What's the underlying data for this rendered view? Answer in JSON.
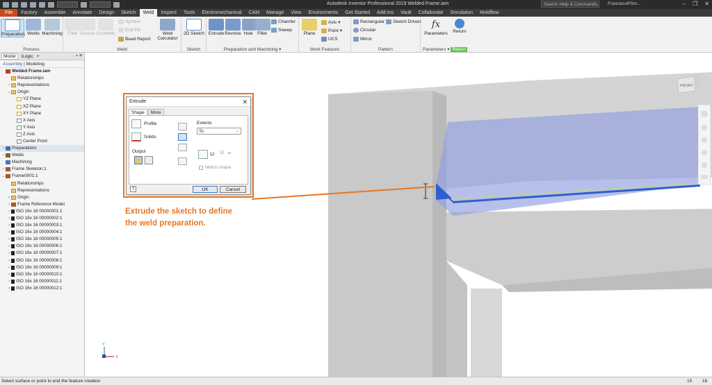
{
  "titlebar": {
    "app_title": "Autodesk Inventor Professional 2019   Welded Frame.iam",
    "search_placeholder": "Search Help & Commands...",
    "user": "FranciscoPSm...",
    "win_controls": [
      "–",
      "❐",
      "✕"
    ]
  },
  "tabs": [
    "File",
    "Factory",
    "Assemble",
    "Annotate",
    "Design",
    "Sketch",
    "Weld",
    "Inspect",
    "Tools",
    "Electromechanical",
    "CAM",
    "Manage",
    "View",
    "Environments",
    "Get Started",
    "Add-Ins",
    "Vault",
    "Collaborate",
    "Simulation",
    "Moldflow"
  ],
  "active_tab": "Weld",
  "ribbon": {
    "process": {
      "title": "Process",
      "preparation": "Preparation",
      "welds": "Welds",
      "machining": "Machining"
    },
    "weld": {
      "title": "Weld",
      "fillet": "Fillet",
      "groove": "Groove",
      "cosmetic": "Cosmetic",
      "symbol": "Symbol",
      "end_fill": "End Fill",
      "bead_report": "Bead Report",
      "weld_calculator_1": "Weld",
      "weld_calculator_2": "Calculator"
    },
    "sketch": {
      "title": "Sketch",
      "sketch_2d": "2D Sketch"
    },
    "prep_machining": {
      "title": "Preparation and Machining",
      "extrude": "Extrude",
      "revolve": "Revolve",
      "hole": "Hole",
      "fillet": "Fillet",
      "chamfer": "Chamfer",
      "sweep": "Sweep"
    },
    "work_features": {
      "title": "Work Features",
      "plane": "Plane",
      "axis": "Axis",
      "point": "Point",
      "ucs": "UCS"
    },
    "pattern": {
      "title": "Pattern",
      "rectangular": "Rectangular",
      "circular": "Circular",
      "mirror": "Mirror",
      "sketch_driven": "Sketch Driven"
    },
    "parameters": {
      "title": "Parameters",
      "parameters": "Parameters",
      "return": "Return",
      "return_title": "Return"
    }
  },
  "browser": {
    "tabs": [
      "Model",
      "iLogic"
    ],
    "mode_assembly": "Assembly",
    "mode_modeling": "Modeling",
    "items": [
      {
        "label": "Welded Frame.iam",
        "indent": 0,
        "icon": "assembly",
        "bold": true,
        "twisty": ""
      },
      {
        "label": "Relationships",
        "indent": 1,
        "icon": "folder",
        "twisty": ""
      },
      {
        "label": "Representations",
        "indent": 1,
        "icon": "folder",
        "twisty": "›"
      },
      {
        "label": "Origin",
        "indent": 1,
        "icon": "folder",
        "twisty": "⌄"
      },
      {
        "label": "YZ Plane",
        "indent": 2,
        "icon": "plane",
        "twisty": ""
      },
      {
        "label": "XZ Plane",
        "indent": 2,
        "icon": "plane",
        "twisty": ""
      },
      {
        "label": "XY Plane",
        "indent": 2,
        "icon": "plane",
        "twisty": ""
      },
      {
        "label": "X Axis",
        "indent": 2,
        "icon": "axis",
        "twisty": ""
      },
      {
        "label": "Y Axis",
        "indent": 2,
        "icon": "axis",
        "twisty": ""
      },
      {
        "label": "Z Axis",
        "indent": 2,
        "icon": "axis",
        "twisty": ""
      },
      {
        "label": "Center Point",
        "indent": 2,
        "icon": "point",
        "twisty": ""
      },
      {
        "label": "Preparations",
        "indent": 0,
        "icon": "prep",
        "twisty": "›",
        "highlight": true
      },
      {
        "label": "Welds",
        "indent": 0,
        "icon": "weld",
        "twisty": "›"
      },
      {
        "label": "Machining",
        "indent": 0,
        "icon": "machining",
        "twisty": ""
      },
      {
        "label": "Frame Skeleton:1",
        "indent": 0,
        "icon": "part",
        "twisty": "›"
      },
      {
        "label": "Frame0001:1",
        "indent": 0,
        "icon": "part",
        "twisty": "⌄"
      },
      {
        "label": "Relationships",
        "indent": 1,
        "icon": "folder",
        "twisty": ""
      },
      {
        "label": "Representations",
        "indent": 1,
        "icon": "folder",
        "twisty": ""
      },
      {
        "label": "Origin",
        "indent": 1,
        "icon": "folder",
        "twisty": "›"
      },
      {
        "label": "Frame Reference Model",
        "indent": 1,
        "icon": "part",
        "twisty": "›"
      },
      {
        "label": "ISO 16x 16 00000001:1",
        "indent": 1,
        "icon": "ibeam",
        "twisty": "›"
      },
      {
        "label": "ISO 16x 16 00000002:1",
        "indent": 1,
        "icon": "ibeam",
        "twisty": "›"
      },
      {
        "label": "ISO 16x 16 00000003:1",
        "indent": 1,
        "icon": "ibeam",
        "twisty": "›"
      },
      {
        "label": "ISO 16x 16 00000004:1",
        "indent": 1,
        "icon": "ibeam",
        "twisty": "›"
      },
      {
        "label": "ISO 16x 16 00000005:1",
        "indent": 1,
        "icon": "ibeam",
        "twisty": "›"
      },
      {
        "label": "ISO 16x 16 00000006:1",
        "indent": 1,
        "icon": "ibeam",
        "twisty": "›"
      },
      {
        "label": "ISO 16x 16 00000007:1",
        "indent": 1,
        "icon": "ibeam",
        "twisty": "›"
      },
      {
        "label": "ISO 16x 16 00000008:1",
        "indent": 1,
        "icon": "ibeam",
        "twisty": "›"
      },
      {
        "label": "ISO 16x 16 00000009:1",
        "indent": 1,
        "icon": "ibeam",
        "twisty": "›"
      },
      {
        "label": "ISO 16x 16 00000010:1",
        "indent": 1,
        "icon": "ibeam",
        "twisty": "›"
      },
      {
        "label": "ISO 16x 16 00000011:1",
        "indent": 1,
        "icon": "ibeam",
        "twisty": "›"
      },
      {
        "label": "ISO 16x 16 00000012:1",
        "indent": 1,
        "icon": "ibeam",
        "twisty": "›"
      }
    ]
  },
  "dialog": {
    "title": "Extrude",
    "tabs": [
      "Shape",
      "More"
    ],
    "profile": "Profile",
    "solids": "Solids",
    "output": "Output",
    "extents": "Extents",
    "extents_value": "To",
    "match_shape": "Match shape",
    "ok": "OK",
    "cancel": "Cancel",
    "help": "?"
  },
  "callout": {
    "line1": "Extrude the sketch to define",
    "line2": "the weld preparation."
  },
  "viewcube_label": "FRONT",
  "triad": {
    "x": "X",
    "y": "Y"
  },
  "status": {
    "message": "Select surface or point to end the feature creation",
    "num1": "15",
    "num2": "16"
  },
  "colors": {
    "accent_orange": "#e87722",
    "file_tab": "#c84a1a",
    "selection_blue": "#2f5fcf",
    "return_green": "#5cc34a"
  }
}
